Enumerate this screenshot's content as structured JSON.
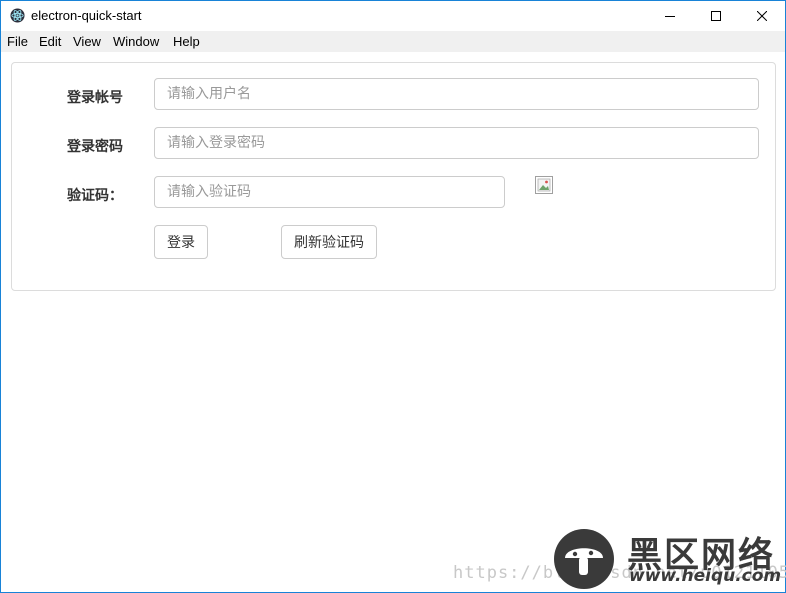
{
  "window": {
    "title": "electron-quick-start"
  },
  "menu": {
    "items": [
      "File",
      "Edit",
      "View",
      "Window",
      "Help"
    ]
  },
  "form": {
    "account_label": "登录帐号",
    "account_placeholder": "请输入用户名",
    "account_value": "",
    "password_label": "登录密码",
    "password_placeholder": "请输入登录密码",
    "password_value": "",
    "captcha_label": "验证码：",
    "captcha_placeholder": "请输入验证码",
    "captcha_value": "",
    "captcha_image_icon": "broken-image-icon",
    "login_button": "登录",
    "refresh_button": "刷新验证码"
  },
  "watermark": {
    "url": "https://blog.csdn.net/u012110518",
    "brand_cn": "黑区网络",
    "brand_domain": "www.heiqu.com",
    "logo_icon": "mushroom-logo-icon"
  },
  "colors": {
    "window_border": "#1883d7",
    "menubar_bg": "#f0f0f0",
    "input_border": "#cccccc"
  }
}
